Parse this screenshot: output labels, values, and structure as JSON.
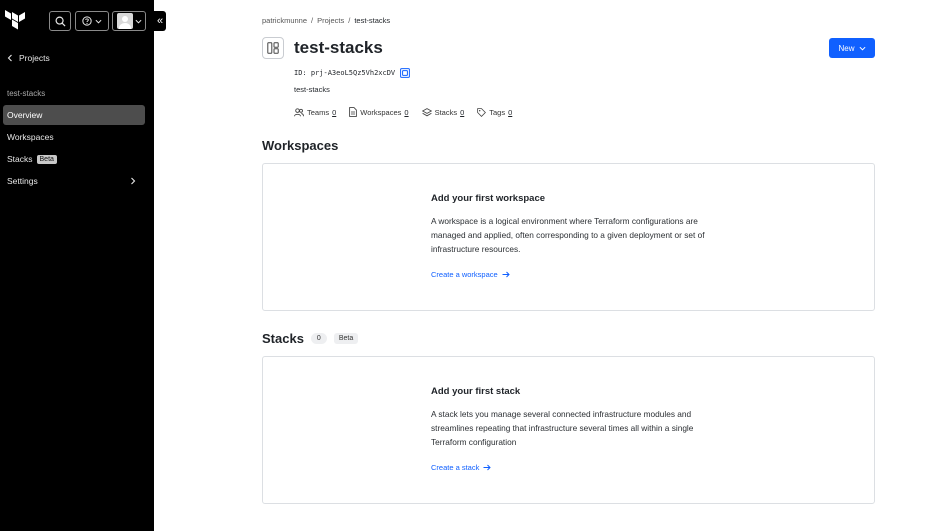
{
  "sidebar": {
    "back_label": "Projects",
    "section_label": "test-stacks",
    "items": [
      {
        "label": "Overview"
      },
      {
        "label": "Workspaces"
      },
      {
        "label": "Stacks",
        "badge": "Beta"
      },
      {
        "label": "Settings"
      }
    ],
    "collapse_glyph": "«"
  },
  "breadcrumb": [
    "patrickmunne",
    "Projects",
    "test-stacks"
  ],
  "breadcrumb_sep": "/",
  "header": {
    "title": "test-stacks",
    "id_text": "ID: prj-A3eoL5Qz5Vh2xcDV",
    "description": "test-stacks",
    "new_button": "New"
  },
  "meta": [
    {
      "label": "Teams",
      "count": "0",
      "icon": "users-icon"
    },
    {
      "label": "Workspaces",
      "count": "0",
      "icon": "file-icon"
    },
    {
      "label": "Stacks",
      "count": "0",
      "icon": "layers-icon"
    },
    {
      "label": "Tags",
      "count": "0",
      "icon": "tag-icon"
    }
  ],
  "workspaces": {
    "section_title": "Workspaces",
    "card_title": "Add your first workspace",
    "card_body": "A workspace is a logical environment where Terraform configurations are managed and applied, often corresponding to a given deployment or set of infrastructure resources.",
    "link": "Create a workspace"
  },
  "stacks": {
    "section_title": "Stacks",
    "count": "0",
    "badge": "Beta",
    "card_title": "Add your first stack",
    "card_body": "A stack lets you manage several connected infrastructure modules and streamlines repeating that infrastructure several times all within a single Terraform configuration",
    "link": "Create a stack"
  },
  "colors": {
    "sidebar_bg": "#000000",
    "active_item_bg": "#4d4d4d",
    "primary": "#1060ff",
    "link": "#1060ff"
  }
}
